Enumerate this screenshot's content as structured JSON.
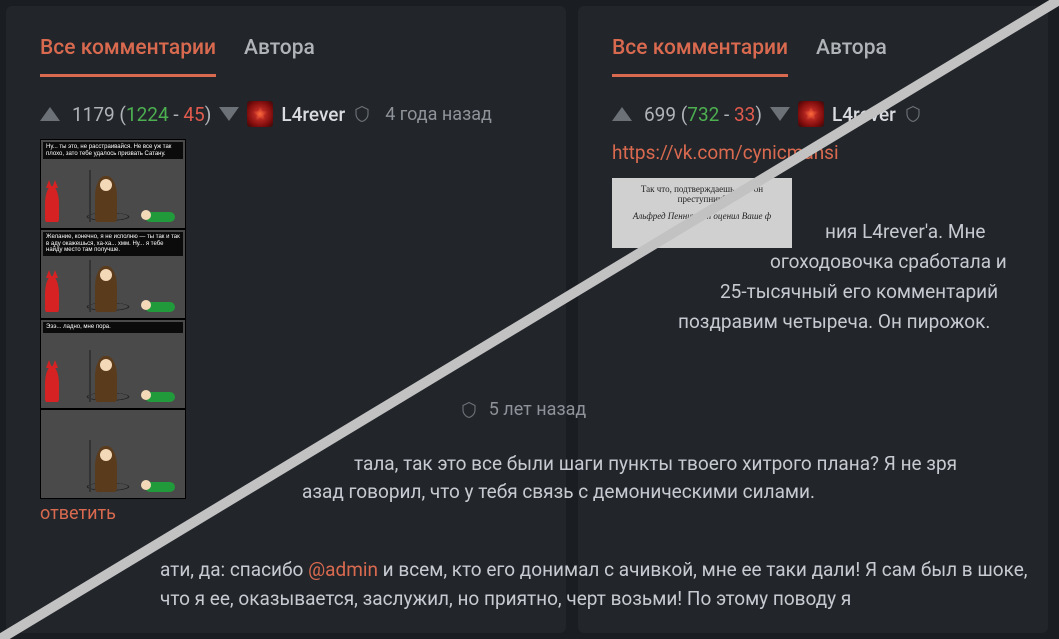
{
  "tabs": {
    "all": "Все комментарии",
    "author": "Автора"
  },
  "left": {
    "score": {
      "total": "1179",
      "plus": "1224",
      "minus": "45"
    },
    "user": "L4rever",
    "time": "4 года назад",
    "reply": "ответить",
    "comic": {
      "p1": "Ну... ты это, не расстраивайся. Не все уж так плохо, зато тебе удалось призвать Сатану.",
      "p2": "Желание, конечно, я не исполню — ты так и так в аду окажешься, ха-ха... хмм. Ну... я тебе найду место там получше.",
      "p3": "Эээ... ладно, мне пора."
    }
  },
  "right": {
    "score": {
      "total": "699",
      "plus": "732",
      "minus": "33"
    },
    "user": "L4rever",
    "link": "https://vk.com/cynicmansi",
    "clip": {
      "l1": "Так что, подтверждаешь, что он преступник?",
      "l2": "Альфред Пенниуорт оценил Ваше ф"
    },
    "text_tail": [
      "ния L4rever'a. Мне",
      "огоходовочка сработала и",
      "25-тысячный его комментарий",
      "поздравим четыреча. Он пирожок."
    ],
    "reply_time": "5 лет назад",
    "para2_a": "тала, так это все были шаги пункты твоего хитрого плана? Я не зря",
    "para2_b": "азад говорил, что у тебя связь с демоническими силами.",
    "para3_pre": "ати, да: спасибо ",
    "para3_mention": "@admin",
    "para3_post": " и всем, кто его донимал с ачивкой, мне ее таки дали! Я сам был в шоке, что я ее, оказывается, заслужил, но приятно, черт возьми! По этому поводу я"
  }
}
